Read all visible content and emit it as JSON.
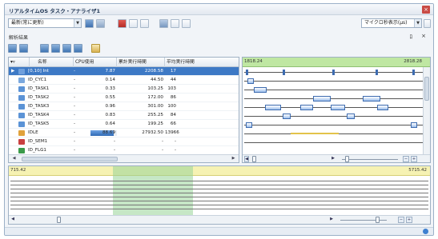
{
  "window": {
    "title": "リアルタイムOS タスク・アナライザ1"
  },
  "toolbar": {
    "mode_combo": "最新(常に更新)",
    "unit_combo": "マイクロ秒表示(μs)"
  },
  "panel": {
    "title": "解析結果",
    "pin": "ﾛ",
    "close": "×"
  },
  "table": {
    "headers": [
      "名称",
      "CPU使用",
      "累計実行時間",
      "平均実行時間"
    ],
    "rows": [
      {
        "name": "[0,10] Int",
        "cpu": "7.87",
        "total": "2208.58",
        "avg": "17",
        "selected": true,
        "icon_color": "#6f9fdc"
      },
      {
        "name": "ID_CYC1",
        "cpu": "0.14",
        "total": "44.50",
        "avg": "44",
        "selected": false,
        "icon_color": "#7aa8de"
      },
      {
        "name": "ID_TASK1",
        "cpu": "0.33",
        "total": "103.25",
        "avg": "103",
        "selected": false,
        "icon_color": "#5b93d6"
      },
      {
        "name": "ID_TASK2",
        "cpu": "0.55",
        "total": "172.00",
        "avg": "86",
        "selected": false,
        "icon_color": "#5b93d6"
      },
      {
        "name": "ID_TASK3",
        "cpu": "0.96",
        "total": "301.00",
        "avg": "100",
        "selected": false,
        "icon_color": "#5b93d6"
      },
      {
        "name": "ID_TASK4",
        "cpu": "0.83",
        "total": "255.25",
        "avg": "84",
        "selected": false,
        "icon_color": "#5b93d6"
      },
      {
        "name": "ID_TASK5",
        "cpu": "0.64",
        "total": "199.25",
        "avg": "66",
        "selected": false,
        "icon_color": "#5b93d6"
      },
      {
        "name": "IDLE",
        "cpu": "88.69",
        "total": "27932.50",
        "avg": "13966",
        "selected": false,
        "icon_color": "#e0a13b",
        "bar": 0.887
      },
      {
        "name": "ID_SEM1",
        "cpu": "-",
        "total": "-",
        "avg": "-",
        "selected": false,
        "icon_color": "#c94040"
      },
      {
        "name": "ID_FLG1",
        "cpu": "-",
        "total": "-",
        "avg": "-",
        "selected": false,
        "icon_color": "#3a9a4a"
      }
    ],
    "dash": "-"
  },
  "gantt": {
    "start_label": "1818.24",
    "end_label": "2818.28"
  },
  "overview": {
    "start_label": "715.42",
    "end_label": "5715.42"
  },
  "colors": {
    "accent": "#3d79c5",
    "gantt_header": "#bfe7a2",
    "overview_header": "#f6f2b3",
    "overview_band": "#98d498"
  }
}
